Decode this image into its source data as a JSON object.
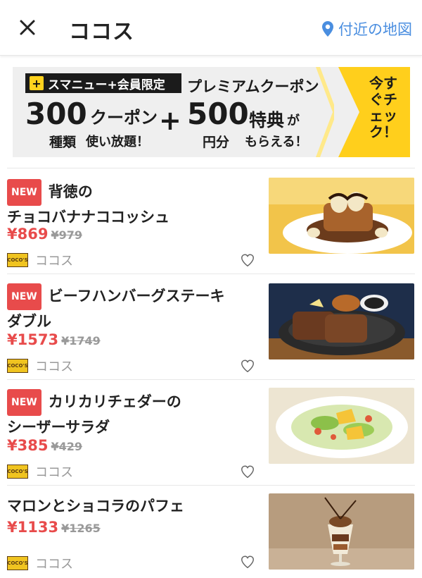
{
  "header": {
    "title": "ココス",
    "map_link": "付近の地図"
  },
  "banner": {
    "tag": "スマニュー+会員限定",
    "premium": "プレミアムクーポン",
    "num1": "300",
    "coupon": "クーポン",
    "kinds": "種類",
    "unlimited": "使い放題！",
    "plus": "+",
    "num2": "500",
    "yen_worth": "円分",
    "tokuten": "特典",
    "ga": "が",
    "moraeru": "もらえる！",
    "cta": "今すぐチェック！"
  },
  "items": [
    {
      "is_new": true,
      "badge": "NEW",
      "name_line1": "背徳の",
      "name_line2": "チョコバナナココッシュ",
      "price": "¥869",
      "old_price": "¥979",
      "brand_logo": "COCO'S",
      "brand": "ココス",
      "image": "chocolate-banana-pancake"
    },
    {
      "is_new": true,
      "badge": "NEW",
      "name_line1": "ビーフハンバーグステーキ",
      "name_line2": "ダブル",
      "price": "¥1573",
      "old_price": "¥1749",
      "brand_logo": "COCO'S",
      "brand": "ココス",
      "image": "hamburg-steak"
    },
    {
      "is_new": true,
      "badge": "NEW",
      "name_line1": "カリカリチェダーの",
      "name_line2": "シーザーサラダ",
      "price": "¥385",
      "old_price": "¥429",
      "brand_logo": "COCO'S",
      "brand": "ココス",
      "image": "caesar-salad"
    },
    {
      "is_new": false,
      "name_line1": "マロンとショコラのパフェ",
      "name_line2": "",
      "price": "¥1133",
      "old_price": "¥1265",
      "brand_logo": "COCO'S",
      "brand": "ココス",
      "image": "marron-chocolat-parfait"
    }
  ],
  "colors": {
    "accent_red": "#e84b4b",
    "link_blue": "#4a8ee0",
    "banner_yellow": "#ffcf1c"
  }
}
